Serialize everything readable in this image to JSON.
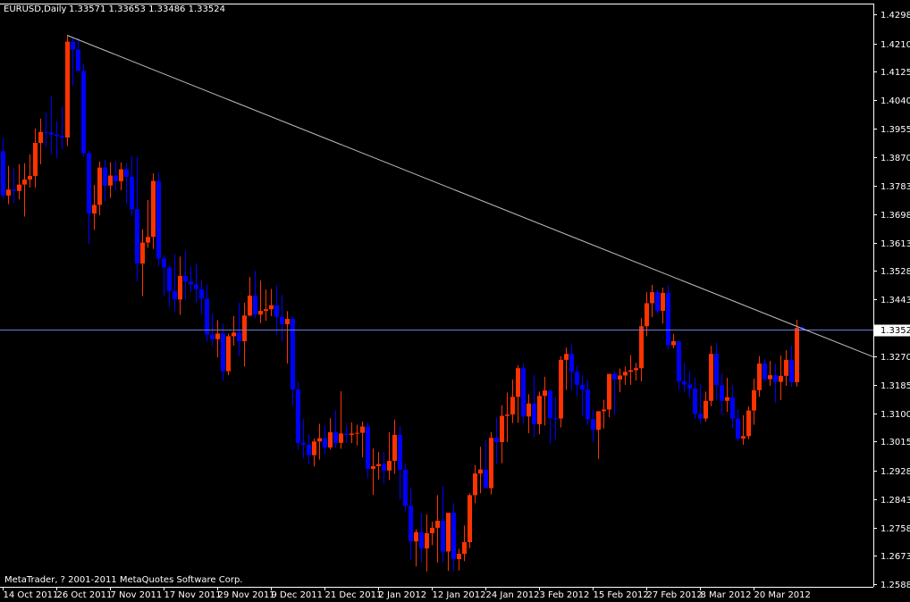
{
  "header": {
    "symbol_label": "EURUSD,Daily",
    "ohlc_text": "1.33571 1.33653 1.33486 1.33524"
  },
  "footer": {
    "copyright": "MetaTrader, ? 2001-2011 MetaQuotes Software Corp."
  },
  "colors": {
    "background": "#000000",
    "bull": "#ff3300",
    "bear": "#0000ff",
    "axis": "#ffffff",
    "trendline": "#c0c0c0",
    "hline": "#6a7bd6",
    "current_price_box": "#ffffff"
  },
  "chart_data": {
    "type": "candlestick",
    "symbol": "EURUSD",
    "timeframe": "Daily",
    "ylim": [
      1.2588,
      1.4298
    ],
    "y_ticks": [
      "1.42980",
      "1.42105",
      "1.41255",
      "1.40405",
      "1.39555",
      "1.38705",
      "1.37830",
      "1.36980",
      "1.36130",
      "1.35280",
      "1.34430",
      "1.33524",
      "1.32705",
      "1.31855",
      "1.31005",
      "1.30155",
      "1.29280",
      "1.28430",
      "1.27580",
      "1.26730",
      "1.25880"
    ],
    "x_ticks": [
      "14 Oct 2011",
      "26 Oct 2011",
      "7 Nov 2011",
      "17 Nov 2011",
      "29 Nov 2011",
      "9 Dec 2011",
      "21 Dec 2011",
      "2 Jan 2012",
      "12 Jan 2012",
      "24 Jan 2012",
      "3 Feb 2012",
      "15 Feb 2012",
      "27 Feb 2012",
      "8 Mar 2012",
      "20 Mar 2012"
    ],
    "current_price": 1.33524,
    "horizontal_line": 1.33524,
    "trendline": {
      "from": {
        "bar": 12,
        "price": 1.4235
      },
      "to": {
        "bar": 160,
        "price": 1.3285
      }
    },
    "candles": [
      [
        1.3887,
        1.3929,
        1.3745,
        1.3754
      ],
      [
        1.3754,
        1.3843,
        1.3728,
        1.3772
      ],
      [
        1.3772,
        1.3836,
        1.3731,
        1.3768
      ],
      [
        1.3768,
        1.3848,
        1.3743,
        1.3787
      ],
      [
        1.3787,
        1.3851,
        1.3691,
        1.3802
      ],
      [
        1.3802,
        1.3878,
        1.3778,
        1.3813
      ],
      [
        1.3813,
        1.3955,
        1.3778,
        1.3912
      ],
      [
        1.3912,
        1.3985,
        1.3848,
        1.3945
      ],
      [
        1.3945,
        1.4005,
        1.3899,
        1.3943
      ],
      [
        1.3943,
        1.4053,
        1.3878,
        1.3937
      ],
      [
        1.3937,
        1.3977,
        1.3866,
        1.3933
      ],
      [
        1.3933,
        1.402,
        1.3892,
        1.3928
      ],
      [
        1.3928,
        1.4235,
        1.3903,
        1.4216
      ],
      [
        1.4216,
        1.4229,
        1.4084,
        1.4192
      ],
      [
        1.4192,
        1.4227,
        1.4131,
        1.4128
      ],
      [
        1.4128,
        1.415,
        1.3871,
        1.3881
      ],
      [
        1.3881,
        1.3888,
        1.361,
        1.37
      ],
      [
        1.37,
        1.3786,
        1.3651,
        1.3726
      ],
      [
        1.3726,
        1.3856,
        1.3695,
        1.3838
      ],
      [
        1.3838,
        1.3862,
        1.3736,
        1.3784
      ],
      [
        1.3784,
        1.3854,
        1.3747,
        1.3814
      ],
      [
        1.3814,
        1.3857,
        1.3769,
        1.3797
      ],
      [
        1.3797,
        1.3853,
        1.377,
        1.3833
      ],
      [
        1.3833,
        1.3851,
        1.3727,
        1.381
      ],
      [
        1.381,
        1.3873,
        1.3693,
        1.3713
      ],
      [
        1.3713,
        1.3871,
        1.3497,
        1.355
      ],
      [
        1.355,
        1.3653,
        1.3452,
        1.3613
      ],
      [
        1.3613,
        1.3741,
        1.3597,
        1.363
      ],
      [
        1.363,
        1.3821,
        1.3594,
        1.3798
      ],
      [
        1.3798,
        1.3824,
        1.3542,
        1.3565
      ],
      [
        1.3565,
        1.3575,
        1.3452,
        1.3538
      ],
      [
        1.3538,
        1.3545,
        1.342,
        1.3467
      ],
      [
        1.3467,
        1.3578,
        1.3404,
        1.3442
      ],
      [
        1.3442,
        1.3571,
        1.3396,
        1.3513
      ],
      [
        1.3513,
        1.3589,
        1.3439,
        1.3496
      ],
      [
        1.3496,
        1.3542,
        1.3464,
        1.3487
      ],
      [
        1.3487,
        1.355,
        1.3433,
        1.3473
      ],
      [
        1.3473,
        1.35,
        1.3398,
        1.3445
      ],
      [
        1.3445,
        1.3487,
        1.3315,
        1.3337
      ],
      [
        1.3337,
        1.34,
        1.3304,
        1.3323
      ],
      [
        1.3323,
        1.338,
        1.3268,
        1.334
      ],
      [
        1.334,
        1.3369,
        1.3198,
        1.3227
      ],
      [
        1.3227,
        1.334,
        1.3215,
        1.3332
      ],
      [
        1.3332,
        1.3392,
        1.3304,
        1.3343
      ],
      [
        1.3343,
        1.3433,
        1.3272,
        1.3317
      ],
      [
        1.3317,
        1.3433,
        1.3241,
        1.3394
      ],
      [
        1.3394,
        1.351,
        1.3392,
        1.3454
      ],
      [
        1.3454,
        1.3528,
        1.3385,
        1.3397
      ],
      [
        1.3397,
        1.3499,
        1.3371,
        1.3408
      ],
      [
        1.3408,
        1.3472,
        1.3378,
        1.3413
      ],
      [
        1.3413,
        1.3474,
        1.3392,
        1.3425
      ],
      [
        1.3425,
        1.3485,
        1.3336,
        1.339
      ],
      [
        1.339,
        1.3456,
        1.3317,
        1.3368
      ],
      [
        1.3368,
        1.3407,
        1.325,
        1.3384
      ],
      [
        1.3384,
        1.3391,
        1.3125,
        1.3172
      ],
      [
        1.3172,
        1.3195,
        1.2991,
        1.3012
      ],
      [
        1.3012,
        1.3084,
        1.2967,
        1.3007
      ],
      [
        1.3007,
        1.3038,
        1.2948,
        1.2975
      ],
      [
        1.2975,
        1.3025,
        1.2941,
        1.3016
      ],
      [
        1.3016,
        1.3069,
        1.2962,
        1.3026
      ],
      [
        1.3026,
        1.3065,
        1.2978,
        1.2998
      ],
      [
        1.2998,
        1.3086,
        1.2992,
        1.3044
      ],
      [
        1.3044,
        1.3111,
        1.2996,
        1.3012
      ],
      [
        1.3012,
        1.3167,
        1.2994,
        1.304
      ],
      [
        1.304,
        1.3066,
        1.3011,
        1.3036
      ],
      [
        1.3036,
        1.3073,
        1.3011,
        1.304
      ],
      [
        1.304,
        1.3066,
        1.3004,
        1.3042
      ],
      [
        1.3042,
        1.3076,
        1.2969,
        1.3061
      ],
      [
        1.3061,
        1.3072,
        1.2906,
        1.2934
      ],
      [
        1.2934,
        1.2995,
        1.2856,
        1.2942
      ],
      [
        1.2942,
        1.2985,
        1.2902,
        1.2948
      ],
      [
        1.2948,
        1.2985,
        1.2889,
        1.2929
      ],
      [
        1.2929,
        1.3044,
        1.2901,
        1.2958
      ],
      [
        1.2958,
        1.3082,
        1.2919,
        1.3036
      ],
      [
        1.3036,
        1.3062,
        1.2842,
        1.2931
      ],
      [
        1.2931,
        1.2951,
        1.2807,
        1.2823
      ],
      [
        1.2823,
        1.2877,
        1.2662,
        1.2716
      ],
      [
        1.2716,
        1.2752,
        1.2641,
        1.2744
      ],
      [
        1.2744,
        1.2801,
        1.2654,
        1.2695
      ],
      [
        1.2695,
        1.2797,
        1.2626,
        1.2741
      ],
      [
        1.2741,
        1.2775,
        1.2705,
        1.2757
      ],
      [
        1.2757,
        1.2855,
        1.2653,
        1.2778
      ],
      [
        1.2778,
        1.2882,
        1.2653,
        1.2686
      ],
      [
        1.2686,
        1.2782,
        1.2628,
        1.2802
      ],
      [
        1.2802,
        1.2831,
        1.2627,
        1.2663
      ],
      [
        1.2663,
        1.2694,
        1.2629,
        1.2679
      ],
      [
        1.2679,
        1.2764,
        1.2657,
        1.2714
      ],
      [
        1.2714,
        1.286,
        1.2696,
        1.2855
      ],
      [
        1.2855,
        1.2945,
        1.2831,
        1.292
      ],
      [
        1.292,
        1.3,
        1.2861,
        1.2932
      ],
      [
        1.2932,
        1.3021,
        1.2891,
        1.2876
      ],
      [
        1.2876,
        1.3044,
        1.2857,
        1.3027
      ],
      [
        1.3027,
        1.3088,
        1.2949,
        1.3014
      ],
      [
        1.3014,
        1.3125,
        1.2951,
        1.3093
      ],
      [
        1.3093,
        1.3163,
        1.3014,
        1.3097
      ],
      [
        1.3097,
        1.3202,
        1.3071,
        1.315
      ],
      [
        1.315,
        1.3245,
        1.3072,
        1.3236
      ],
      [
        1.3236,
        1.3251,
        1.307,
        1.3091
      ],
      [
        1.3091,
        1.3158,
        1.3041,
        1.313
      ],
      [
        1.313,
        1.3216,
        1.303,
        1.3068
      ],
      [
        1.3068,
        1.3166,
        1.3038,
        1.3153
      ],
      [
        1.3153,
        1.321,
        1.3064,
        1.3169
      ],
      [
        1.3169,
        1.3165,
        1.3007,
        1.3086
      ],
      [
        1.3086,
        1.3149,
        1.3022,
        1.3085
      ],
      [
        1.3085,
        1.3272,
        1.3058,
        1.3261
      ],
      [
        1.3261,
        1.3298,
        1.3171,
        1.3279
      ],
      [
        1.3279,
        1.3307,
        1.317,
        1.3225
      ],
      [
        1.3225,
        1.3243,
        1.3151,
        1.3186
      ],
      [
        1.3186,
        1.3216,
        1.3093,
        1.3172
      ],
      [
        1.3172,
        1.3202,
        1.3066,
        1.3083
      ],
      [
        1.3083,
        1.3111,
        1.3014,
        1.3051
      ],
      [
        1.3051,
        1.3073,
        1.2963,
        1.3107
      ],
      [
        1.3107,
        1.3141,
        1.3055,
        1.3112
      ],
      [
        1.3112,
        1.3209,
        1.3089,
        1.3219
      ],
      [
        1.3219,
        1.3227,
        1.3096,
        1.3202
      ],
      [
        1.3202,
        1.3235,
        1.3164,
        1.3214
      ],
      [
        1.3214,
        1.3241,
        1.3186,
        1.3225
      ],
      [
        1.3225,
        1.3275,
        1.3186,
        1.323
      ],
      [
        1.323,
        1.3252,
        1.3199,
        1.3236
      ],
      [
        1.3236,
        1.3386,
        1.3196,
        1.3362
      ],
      [
        1.3362,
        1.3464,
        1.3332,
        1.3431
      ],
      [
        1.3431,
        1.3486,
        1.3389,
        1.3464
      ],
      [
        1.3464,
        1.3471,
        1.3398,
        1.3408
      ],
      [
        1.3408,
        1.3478,
        1.337,
        1.3462
      ],
      [
        1.3462,
        1.3486,
        1.3292,
        1.3305
      ],
      [
        1.3305,
        1.3339,
        1.3296,
        1.3317
      ],
      [
        1.3317,
        1.3311,
        1.3171,
        1.3196
      ],
      [
        1.3196,
        1.3251,
        1.3164,
        1.3187
      ],
      [
        1.3187,
        1.3228,
        1.3146,
        1.3175
      ],
      [
        1.3175,
        1.3208,
        1.3084,
        1.3099
      ],
      [
        1.3099,
        1.3189,
        1.307,
        1.3085
      ],
      [
        1.3085,
        1.3166,
        1.3076,
        1.3138
      ],
      [
        1.3138,
        1.3303,
        1.3122,
        1.3279
      ],
      [
        1.3279,
        1.3312,
        1.3138,
        1.3185
      ],
      [
        1.3185,
        1.3221,
        1.3096,
        1.3138
      ],
      [
        1.3138,
        1.3207,
        1.3105,
        1.3149
      ],
      [
        1.3149,
        1.3185,
        1.3057,
        1.3085
      ],
      [
        1.3085,
        1.3112,
        1.3018,
        1.3025
      ],
      [
        1.3025,
        1.3095,
        1.3006,
        1.3032
      ],
      [
        1.3032,
        1.3121,
        1.3023,
        1.3109
      ],
      [
        1.3109,
        1.3205,
        1.3066,
        1.317
      ],
      [
        1.317,
        1.3272,
        1.315,
        1.325
      ],
      [
        1.325,
        1.3265,
        1.3195,
        1.3203
      ],
      [
        1.3203,
        1.3258,
        1.3183,
        1.3215
      ],
      [
        1.3215,
        1.325,
        1.3131,
        1.3195
      ],
      [
        1.3195,
        1.3274,
        1.314,
        1.3213
      ],
      [
        1.3213,
        1.329,
        1.3183,
        1.3261
      ],
      [
        1.3261,
        1.3303,
        1.318,
        1.3194
      ],
      [
        1.3194,
        1.3381,
        1.3181,
        1.3357
      ],
      [
        1.3357,
        1.3365,
        1.3349,
        1.3352
      ]
    ]
  }
}
